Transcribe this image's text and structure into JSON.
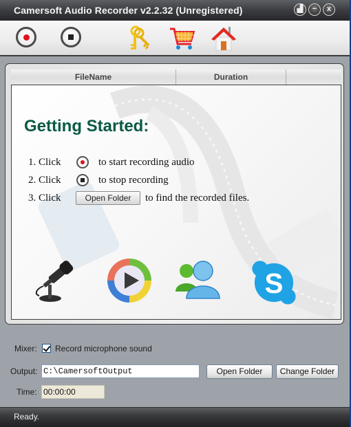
{
  "window": {
    "title": "Camersoft Audio Recorder v2.2.32 (Unregistered)",
    "controls": [
      {
        "name": "restore",
        "icon": "restore-icon",
        "glyph": "▟"
      },
      {
        "name": "minimize",
        "icon": "minimize-icon",
        "glyph": "−"
      },
      {
        "name": "close",
        "icon": "close-icon",
        "glyph": "x"
      }
    ]
  },
  "toolbar": {
    "buttons": [
      {
        "name": "record",
        "icon": "record-icon"
      },
      {
        "name": "stop",
        "icon": "stop-icon"
      },
      {
        "name": "register",
        "icon": "keys-icon"
      },
      {
        "name": "buy",
        "icon": "shopping-cart-icon"
      },
      {
        "name": "home",
        "icon": "home-icon"
      }
    ]
  },
  "file_list": {
    "columns": [
      "FileName",
      "Duration"
    ],
    "rows": []
  },
  "getting_started": {
    "heading": "Getting Started:",
    "steps": [
      {
        "prefix": "1. Click",
        "icon": "record-icon",
        "suffix": "to start recording audio"
      },
      {
        "prefix": "2. Click",
        "icon": "stop-icon",
        "suffix": "to stop recording"
      },
      {
        "prefix": "3. Click",
        "button_label": "Open Folder",
        "suffix": "to find the recorded files."
      }
    ],
    "app_icons": [
      "microphone-icon",
      "media-player-icon",
      "messenger-icon",
      "skype-icon"
    ]
  },
  "controls": {
    "mixer_label": "Mixer:",
    "mixer_checkbox_label": "Record microphone sound",
    "mixer_checked": true,
    "output_label": "Output:",
    "output_value": "C:\\CamersoftOutput",
    "open_folder_label": "Open Folder",
    "change_folder_label": "Change Folder",
    "time_label": "Time:",
    "time_value": "00:00:00"
  },
  "status": {
    "text": "Ready."
  },
  "colors": {
    "heading": "#0a5a45",
    "record_red": "#e0141e",
    "title_bar": "#3b3d40",
    "window_body": "#9ea3a9"
  }
}
